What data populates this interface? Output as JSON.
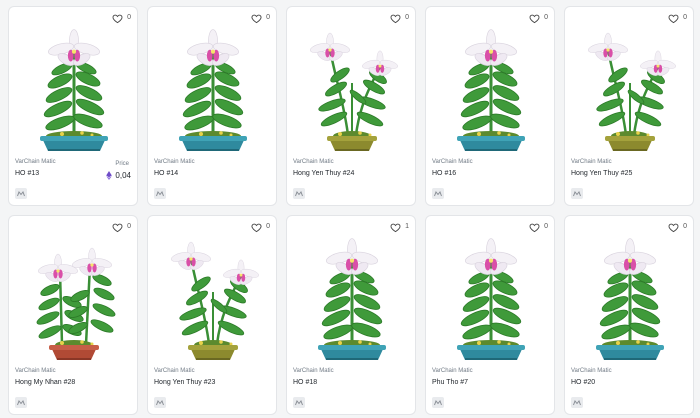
{
  "colors": {
    "card_border": "#e3e5e8",
    "text_primary": "#24292f",
    "text_secondary": "#707a85",
    "eth_purple": "#6f4cc8"
  },
  "icons": {
    "favorite": "heart-outline-icon",
    "currency": "ethereum-icon",
    "chain": "chain-badge-icon"
  },
  "cards": [
    {
      "collection": "VarChain Matic",
      "name": "HO #13",
      "favorites": "0",
      "price_label": "Price",
      "price": "0,04",
      "pot": "blue"
    },
    {
      "collection": "VarChain Matic",
      "name": "HO #14",
      "favorites": "0",
      "pot": "blue"
    },
    {
      "collection": "VarChain Matic",
      "name": "Hong Yen Thuy #24",
      "favorites": "0",
      "pot": "olive"
    },
    {
      "collection": "VarChain Matic",
      "name": "HO #16",
      "favorites": "0",
      "pot": "blue"
    },
    {
      "collection": "VarChain Matic",
      "name": "Hong Yen Thuy #25",
      "favorites": "0",
      "pot": "olive"
    },
    {
      "collection": "VarChain Matic",
      "name": "Hong My Nhan #28",
      "favorites": "0",
      "pot": "terracotta"
    },
    {
      "collection": "VarChain Matic",
      "name": "Hong Yen Thuy #23",
      "favorites": "0",
      "pot": "olive"
    },
    {
      "collection": "VarChain Matic",
      "name": "HO #18",
      "favorites": "1",
      "pot": "blue"
    },
    {
      "collection": "VarChain Matic",
      "name": "Phu Tho #7",
      "favorites": "0",
      "pot": "blue"
    },
    {
      "collection": "VarChain Matic",
      "name": "HO #20",
      "favorites": "0",
      "pot": "blue"
    }
  ]
}
